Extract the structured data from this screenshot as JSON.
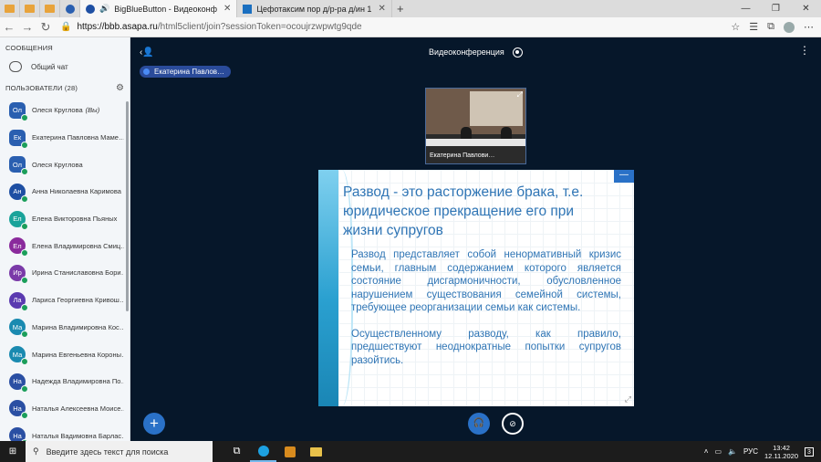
{
  "browser": {
    "tabs": [
      {
        "label": "BigBlueButton - Видеоконф",
        "active": true
      },
      {
        "label": "Цефотаксим пор д/р-ра д/ин 1",
        "active": false
      }
    ],
    "url_host": "https://bbb.asapa.ru",
    "url_path": "/html5client/join?sessionToken=ocoujrzwpwtg9qde"
  },
  "sidebar": {
    "messages_header": "СООБЩЕНИЯ",
    "public_chat": "Общий чат",
    "users_header": "ПОЛЬЗОВАТЕЛИ (28)",
    "users": [
      {
        "initials": "Ол",
        "name": "Олеся Круглова",
        "suffix": "(Вы)",
        "color": "#2a5fb0",
        "round": false
      },
      {
        "initials": "Ек",
        "name": "Екатерина Павловна Маме…",
        "suffix": "",
        "color": "#2a5fb0",
        "round": false
      },
      {
        "initials": "Ол",
        "name": "Олеся Круглова",
        "suffix": "",
        "color": "#2a5fb0",
        "round": false
      },
      {
        "initials": "Ан",
        "name": "Анна Николаевна Каримова",
        "suffix": "",
        "color": "#1e4fa3",
        "round": true
      },
      {
        "initials": "Ел",
        "name": "Елена Викторовна Пьяных",
        "suffix": "",
        "color": "#1aa39a",
        "round": true
      },
      {
        "initials": "Ел",
        "name": "Елена Владимировна Смиц…",
        "suffix": "",
        "color": "#8a2a9c",
        "round": true
      },
      {
        "initials": "Ир",
        "name": "Ирина Станиславовна Бори…",
        "suffix": "",
        "color": "#7a3aa8",
        "round": true
      },
      {
        "initials": "Ла",
        "name": "Лариса Георгиевна Кривош…",
        "suffix": "",
        "color": "#5a3ab0",
        "round": true
      },
      {
        "initials": "Ма",
        "name": "Марина Владимировна Кос…",
        "suffix": "",
        "color": "#1a8ab0",
        "round": true
      },
      {
        "initials": "Ма",
        "name": "Марина Евгеньевна Короны…",
        "suffix": "",
        "color": "#1a8ab0",
        "round": true
      },
      {
        "initials": "На",
        "name": "Надежда Владимировна По…",
        "suffix": "",
        "color": "#2a4fa3",
        "round": true
      },
      {
        "initials": "На",
        "name": "Наталья Алексеевна Моисе…",
        "suffix": "",
        "color": "#2a4fa3",
        "round": true
      },
      {
        "initials": "На",
        "name": "Наталья Вадимовна Барлас…",
        "suffix": "",
        "color": "#2a4fa3",
        "round": true
      }
    ]
  },
  "main": {
    "meeting_title": "Видеоконференция",
    "talking_user": "Екатерина Павлов…",
    "video_name": "Екатерина Павлови…",
    "slide": {
      "title": "Развод - это расторжение брака, т.е. юридическое прекращение его при жизни супругов",
      "para1": "Развод представляет собой ненормативный кризис семьи, главным содержанием которого является состояние дисгармоничности, обусловленное нарушением существования семейной системы, требующее реорганизации семьи как системы.",
      "para2": "Осуществленному разводу, как правило, предшествуют неоднократные попытки супругов разойтись."
    }
  },
  "taskbar": {
    "search_placeholder": "Введите здесь текст для поиска",
    "language": "РУС",
    "time": "13:42",
    "date": "12.11.2020",
    "notifications": "3"
  },
  "colors": {
    "accent": "#2a71c7",
    "background": "#06172a",
    "sidebar": "#f3f6f9",
    "slide_text": "#2f75b5"
  }
}
